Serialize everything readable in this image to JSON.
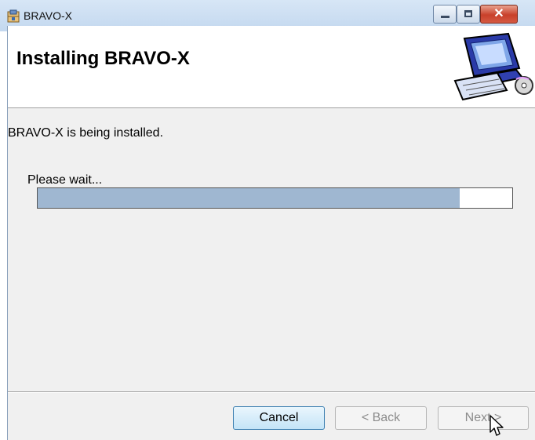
{
  "window": {
    "title": "BRAVO-X",
    "icon": "installer-package-icon",
    "controls": [
      "minimize-icon",
      "maximize-icon",
      "close-icon"
    ]
  },
  "banner": {
    "title": "Installing BRAVO-X",
    "graphic": "computer-installation-icon"
  },
  "body": {
    "status": "BRAVO-X is being installed.",
    "wait_label": "Please wait...",
    "progress_fraction": 0.89
  },
  "buttons": {
    "cancel": "Cancel",
    "back": "< Back",
    "next": "Next >"
  },
  "colors": {
    "progress_fill": "#9fb7d1",
    "client_bg": "#f0f0f0"
  }
}
